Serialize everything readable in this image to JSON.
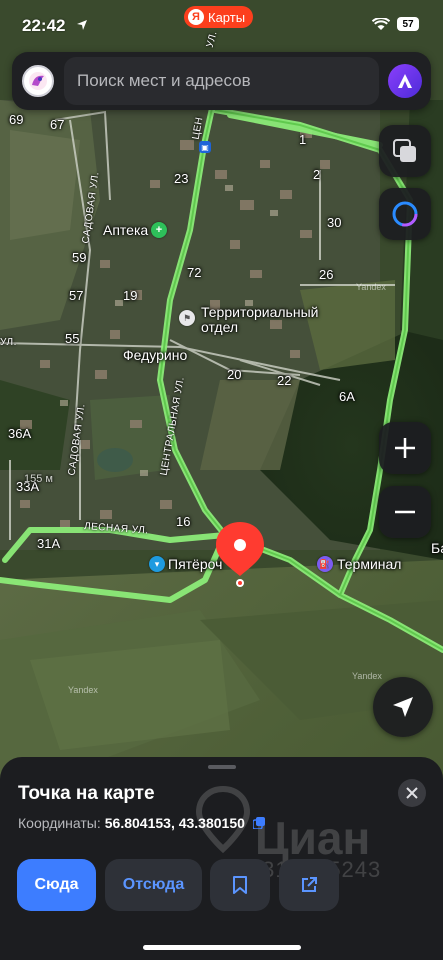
{
  "status_bar": {
    "time": "22:42",
    "brand_icon_letter": "Я",
    "brand_app": "Карты",
    "battery": "57",
    "icons": [
      "location-arrow-icon",
      "wifi-icon",
      "battery-icon"
    ]
  },
  "search": {
    "placeholder": "Поиск мест и адресов",
    "value": ""
  },
  "map": {
    "labels": {
      "n69": "69",
      "n67": "67",
      "n23": "23",
      "n1": "1",
      "n2": "2",
      "n30": "30",
      "n59": "59",
      "n57": "57",
      "n19": "19",
      "n72": "72",
      "n26": "26",
      "n55": "55",
      "n20": "20",
      "n22": "22",
      "n6a": "6А",
      "n36a": "36А",
      "n33a": "33А",
      "n31a": "31А",
      "n16": "16",
      "ba": "Ба",
      "apteka": "Аптека",
      "territorial_1": "Территориальный",
      "territorial_2": "отдел",
      "fedurino": "Федурино",
      "pyaterochka": "Пятёроч",
      "terminal": "Терминал",
      "scale": "155 м",
      "yandex_1": "Yandex",
      "yandex_2": "Yandex",
      "yandex_3": "Yandex"
    },
    "streets": {
      "sadovaya_top": "САДОВАЯ УЛ.",
      "sadovaya_mid": "САДОВАЯ УЛ.",
      "tsentralnaya": "ЦЕНТРАЛЬНАЯ УЛ.",
      "tsentr_top": "ЦЕН",
      "lesnaya": "ЛЕСНАЯ УЛ.",
      "ul_left": "УЛ.",
      "ul_top": "УЛ."
    },
    "colors": {
      "road": "#8ef07a",
      "pin": "#ff3b30",
      "pharmacy": "#2ec05a",
      "shop": "#1e9be0",
      "fuel": "#7b5cf0"
    }
  },
  "controls": {
    "layers_icon": "layers-icon",
    "alice_icon": "alice-icon",
    "zoom_in_icon": "plus-icon",
    "zoom_out_icon": "minus-icon",
    "locate_icon": "navigation-arrow-icon"
  },
  "sheet": {
    "title": "Точка на карте",
    "coords_label": "Координаты:",
    "coords_value": "56.804153, 43.380150",
    "watermark_text": "Циан",
    "watermark_id": "ID 318665243",
    "actions": {
      "here": "Сюда",
      "from": "Отсюда"
    }
  }
}
